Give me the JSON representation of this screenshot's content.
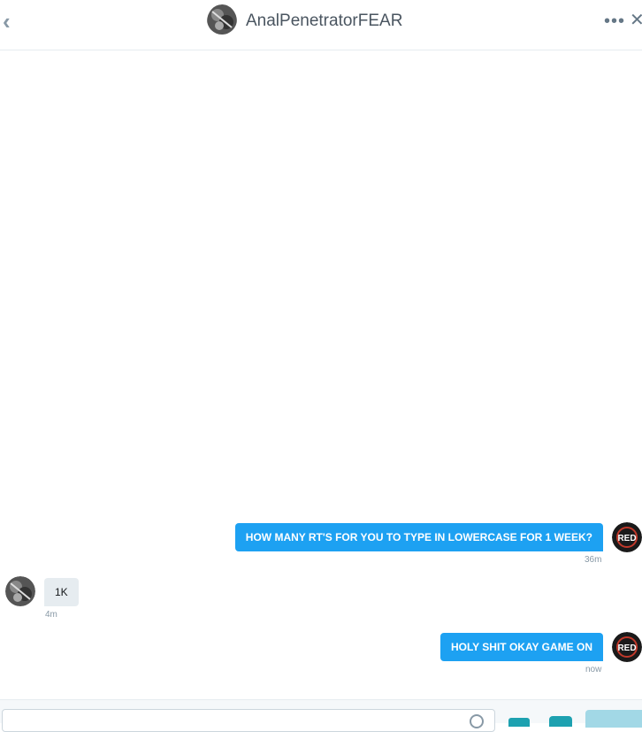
{
  "header": {
    "title": "AnalPenetratorFEAR",
    "back_icon": "chevron-left-icon",
    "more_icon": "more-dots-icon",
    "close_icon": "close-icon"
  },
  "messages": [
    {
      "direction": "outgoing",
      "text": "HOW MANY RT'S FOR YOU TO TYPE IN LOWERCASE FOR 1 WEEK?",
      "time": "36m"
    },
    {
      "direction": "incoming",
      "text": "1K",
      "time": "4m"
    },
    {
      "direction": "outgoing",
      "text": "HOLY SHIT OKAY GAME ON",
      "time": "now"
    }
  ],
  "composer": {
    "placeholder": "",
    "emoji_icon": "emoji-icon",
    "gif_icon": "gif-icon",
    "camera_icon": "camera-icon",
    "send_label": ""
  },
  "colors": {
    "outgoing_bubble": "#1da1f2",
    "incoming_bubble": "#e6ecf0",
    "accent": "#1da1b0"
  }
}
